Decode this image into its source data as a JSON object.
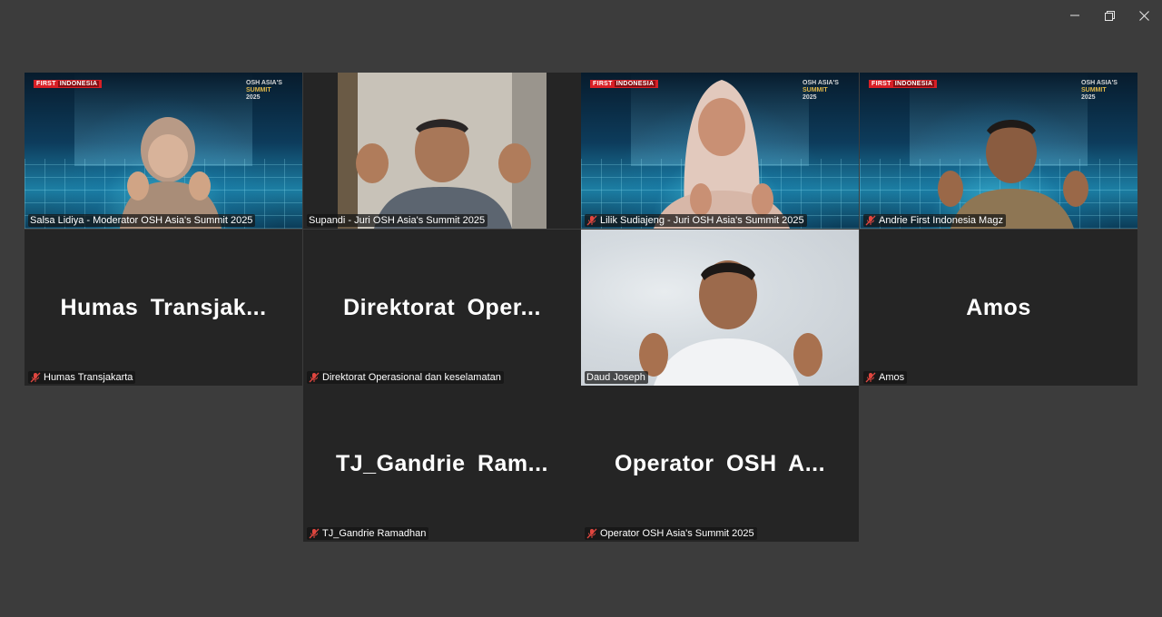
{
  "window": {
    "controls": {
      "minimize": "minimize-icon",
      "restore": "restore-icon",
      "close": "close-icon"
    }
  },
  "brand_colors": {
    "active_speaker_border": "#2fd18a",
    "tile_bg": "#252525",
    "window_bg": "#3c3c3c",
    "muted_mic": "#e0463f"
  },
  "participants": [
    {
      "display": "Salsa Lidiya - Moderator OSH Asia's Summit 2025",
      "video": true,
      "active": true,
      "muted": false
    },
    {
      "display": "Supandi - Juri OSH Asia's Summit 2025",
      "video": true,
      "muted": false
    },
    {
      "display": "Lilik Sudiajeng - Juri OSH Asia's Summit 2025",
      "video": true,
      "muted": true
    },
    {
      "display": "Andrie First Indonesia Magz",
      "video": true,
      "muted": true
    },
    {
      "display": "Humas Transjakarta",
      "tile_name": "Humas Transjak...",
      "video": false,
      "muted": true
    },
    {
      "display": "Direktorat Operasional dan keselamatan",
      "tile_name": "Direktorat Oper...",
      "video": false,
      "muted": true
    },
    {
      "display": "Daud Joseph",
      "video": true,
      "muted": false
    },
    {
      "display": "Amos",
      "tile_name": "Amos",
      "video": false,
      "muted": true
    },
    {
      "display": "TJ_Gandrie Ramadhan",
      "tile_name": "TJ_Gandrie Ram...",
      "video": false,
      "muted": true
    },
    {
      "display": "Operator OSH Asia's Summit 2025",
      "tile_name": "Operator OSH A...",
      "video": false,
      "muted": true
    }
  ],
  "backdrop": {
    "brand_left": "FIRST",
    "brand_right": "INDONESIA",
    "event_line1": "OSH ASIA'S",
    "event_line2": "SUMMIT",
    "event_line3": "2025"
  }
}
